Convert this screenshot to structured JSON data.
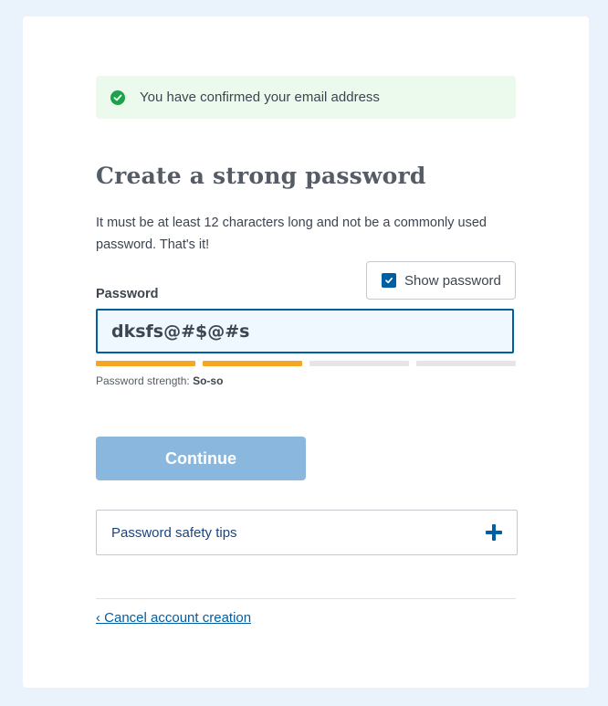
{
  "alert": {
    "icon": "check-circle-icon",
    "text": "You have confirmed your email address",
    "color": "#1aa34a"
  },
  "heading": "Create a strong password",
  "help_text": "It must be at least 12 characters long and not be a commonly used password. That's it!",
  "show_password": {
    "label": "Show password",
    "checked": true
  },
  "password_field": {
    "label": "Password",
    "value": "dksfs@#$@#s"
  },
  "strength": {
    "label": "Password strength: ",
    "value": "So-so",
    "filled_segments": 2,
    "total_segments": 4,
    "color": "#f5a623"
  },
  "continue_button": {
    "label": "Continue"
  },
  "tips": {
    "label": "Password safety tips",
    "icon": "plus-icon"
  },
  "cancel_link": "‹ Cancel account creation"
}
